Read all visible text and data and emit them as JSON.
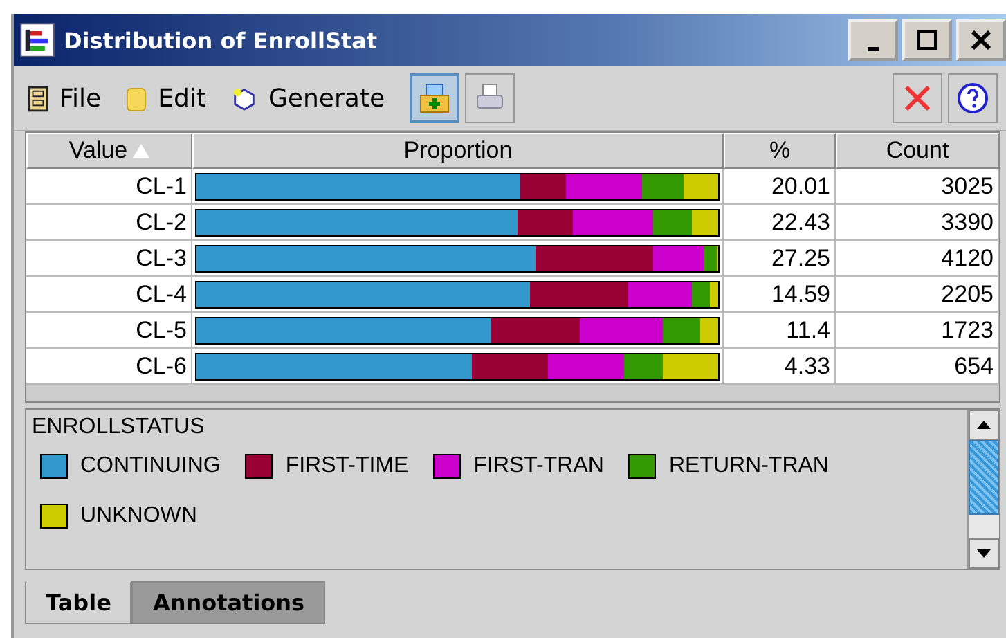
{
  "window": {
    "title": "Distribution of EnrollStat"
  },
  "menu": [
    {
      "label": "File",
      "kind": "file"
    },
    {
      "label": "Edit",
      "kind": "edit"
    },
    {
      "label": "Generate",
      "kind": "generate"
    }
  ],
  "toolbar": [
    {
      "kind": "add",
      "selected": true
    },
    {
      "kind": "print",
      "selected": false
    }
  ],
  "table": {
    "columns": [
      {
        "label": "Value",
        "sorted": true
      },
      {
        "label": "Proportion",
        "sorted": false
      },
      {
        "label": "%",
        "sorted": false
      },
      {
        "label": "Count",
        "sorted": false
      }
    ],
    "rows": [
      {
        "value": "CL-1",
        "first_segment": {
          "level": 0.622
        },
        "last_segment": {
          "level": 0.066
        },
        "percent": "20.01",
        "count": "3025"
      },
      {
        "value": "CL-2",
        "first_segment": {
          "level": 0.616
        },
        "last_segment": {
          "level": 0.051
        },
        "percent": "22.43",
        "count": "3390"
      },
      {
        "value": "CL-3",
        "first_segment": {
          "level": 0.651
        },
        "last_segment": {
          "level": 0.003
        },
        "percent": "27.25",
        "count": "4120"
      },
      {
        "value": "CL-4",
        "first_segment": {
          "level": 0.638
        },
        "last_segment": {
          "level": 0.016
        },
        "percent": "14.59",
        "count": "2205"
      },
      {
        "value": "CL-5",
        "first_segment": {
          "level": 0.566
        },
        "last_segment": {
          "level": 0.035
        },
        "percent": "11.4",
        "count": "1723"
      },
      {
        "value": "CL-6",
        "first_segment": {
          "level": 0.529
        },
        "last_segment": {
          "level": 0.105
        },
        "percent": "4.33",
        "count": "654"
      }
    ]
  },
  "legend": {
    "title": "ENROLLSTATUS",
    "items": [
      {
        "label": "CONTINUING",
        "color": "#3399cc"
      },
      {
        "label": "FIRST-TIME",
        "color": "#990033"
      },
      {
        "label": "FIRST-TRAN",
        "color": "#cc00cc"
      },
      {
        "label": "RETURN-TRAN",
        "color": "#339900"
      },
      {
        "label": "UNKNOWN",
        "color": "#cccc00"
      }
    ]
  },
  "tabs": [
    {
      "label": "Table",
      "selected": true
    },
    {
      "label": "Annotations",
      "selected": false
    }
  ]
}
